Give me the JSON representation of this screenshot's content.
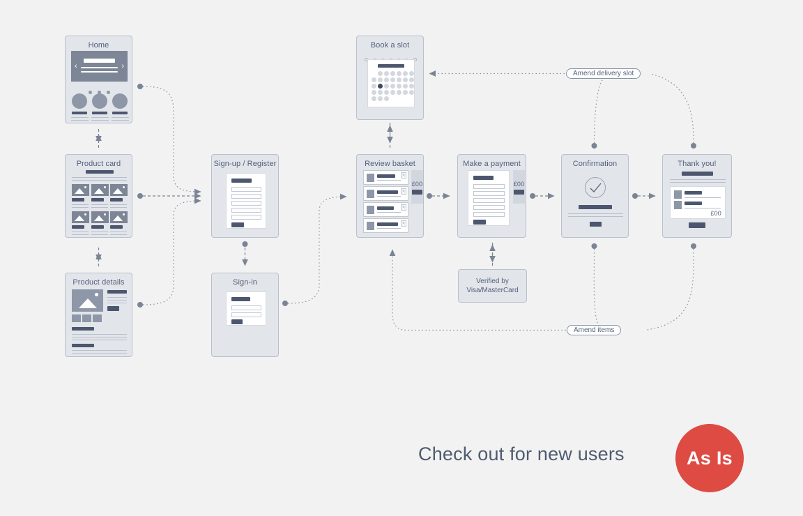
{
  "diagram": {
    "title": "Check out for new users",
    "badge_label": "As Is",
    "badge_color": "#dd4b43",
    "background_color": "#f2f2f2",
    "node_fill": "#e2e5ea",
    "node_border": "#b9bfcb",
    "ink": "#4c566e"
  },
  "nodes": {
    "home": {
      "title": "Home"
    },
    "product_card": {
      "title": "Product card"
    },
    "product_details": {
      "title": "Product details"
    },
    "signup": {
      "title": "Sign-up / Register"
    },
    "signin": {
      "title": "Sign-in"
    },
    "book_slot": {
      "title": "Book a slot"
    },
    "review_basket": {
      "title": "Review basket",
      "price": "£00"
    },
    "make_payment": {
      "title": "Make a payment",
      "price": "£00"
    },
    "confirmation": {
      "title": "Confirmation"
    },
    "thank_you": {
      "title": "Thank you!",
      "price": "£00"
    },
    "verified": {
      "title": "Verified by",
      "title2": "Visa/MasterCard"
    }
  },
  "edge_labels": {
    "amend_delivery_slot": "Amend delivery slot",
    "amend_items": "Amend items"
  },
  "chart_data": {
    "type": "diagram",
    "title": "Check out for new users",
    "nodes": [
      "Home",
      "Product card",
      "Product details",
      "Sign-up / Register",
      "Sign-in",
      "Book a slot",
      "Review basket",
      "Make a payment",
      "Confirmation",
      "Thank you!",
      "Verified by Visa/MasterCard"
    ],
    "edges": [
      {
        "from": "Home",
        "to": "Product card",
        "style": "dashed-bidirectional"
      },
      {
        "from": "Product card",
        "to": "Product details",
        "style": "dashed-bidirectional"
      },
      {
        "from": "Home",
        "to": "Sign-up / Register",
        "style": "dotted-arrow"
      },
      {
        "from": "Product card",
        "to": "Sign-up / Register",
        "style": "dotted-arrow"
      },
      {
        "from": "Product details",
        "to": "Sign-up / Register",
        "style": "dotted-arrow"
      },
      {
        "from": "Sign-up / Register",
        "to": "Sign-in",
        "style": "dashed-arrow"
      },
      {
        "from": "Sign-in",
        "to": "Review basket",
        "style": "dotted-arrow"
      },
      {
        "from": "Review basket",
        "to": "Book a slot",
        "style": "dashed-bidirectional"
      },
      {
        "from": "Review basket",
        "to": "Make a payment",
        "style": "dashed-bidirectional"
      },
      {
        "from": "Make a payment",
        "to": "Verified by Visa/MasterCard",
        "style": "dashed-bidirectional"
      },
      {
        "from": "Make a payment",
        "to": "Confirmation",
        "style": "dashed-bidirectional"
      },
      {
        "from": "Confirmation",
        "to": "Thank you!",
        "style": "dashed-bidirectional"
      },
      {
        "from": "Thank you!",
        "to": "Book a slot",
        "label": "Amend delivery slot",
        "style": "dotted-arrow"
      },
      {
        "from": "Confirmation",
        "to": "Book a slot",
        "label": "Amend delivery slot",
        "style": "dotted-arrow"
      },
      {
        "from": "Thank you!",
        "to": "Review basket",
        "label": "Amend items",
        "style": "dotted-arrow"
      },
      {
        "from": "Confirmation",
        "to": "Review basket",
        "label": "Amend items",
        "style": "dotted-arrow"
      }
    ]
  }
}
